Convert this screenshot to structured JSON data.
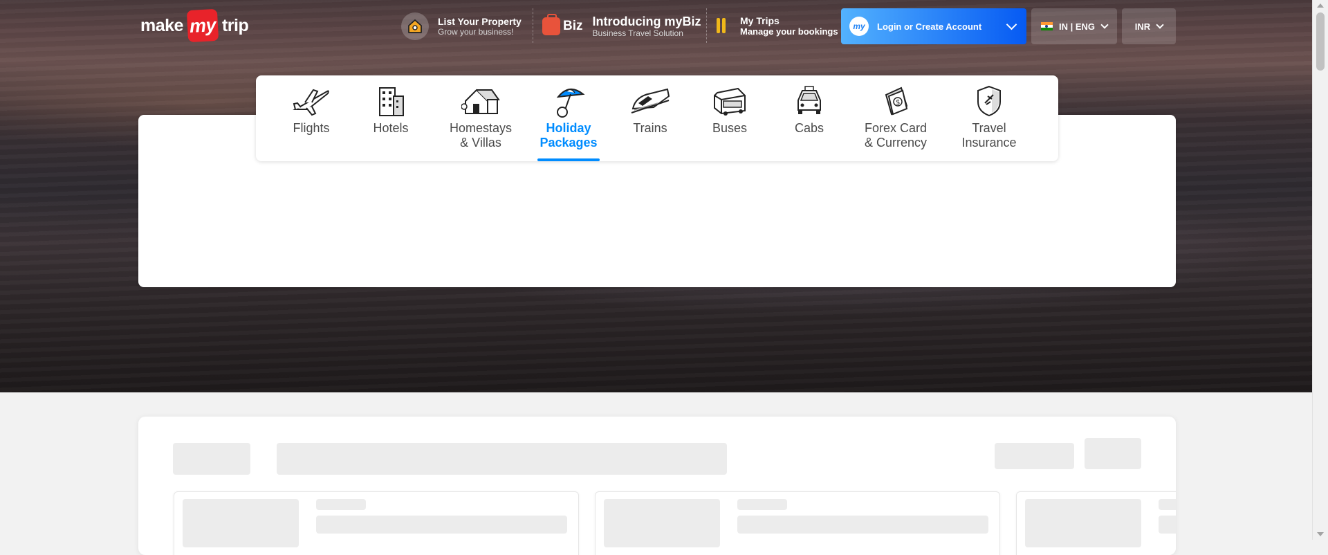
{
  "header": {
    "logo": {
      "part1": "make",
      "part2": "my",
      "part3": "trip"
    },
    "list_property": {
      "title": "List Your Property",
      "subtitle": "Grow your business!"
    },
    "mybiz": {
      "badge": "Biz",
      "title": "Introducing myBiz",
      "subtitle": "Business Travel Solution"
    },
    "my_trips": {
      "title": "My Trips",
      "subtitle": "Manage your bookings"
    },
    "login": {
      "avatar_text": "my",
      "label": "Login or Create Account"
    },
    "language": {
      "label": "IN | ENG"
    },
    "currency": {
      "label": "INR"
    }
  },
  "nav": {
    "items": [
      {
        "label": "Flights",
        "icon": "airplane-icon"
      },
      {
        "label": "Hotels",
        "icon": "hotel-building-icon"
      },
      {
        "label": "Homestays\n& Villas",
        "icon": "house-icon"
      },
      {
        "label": "Holiday\nPackages",
        "icon": "beach-umbrella-icon",
        "active": true
      },
      {
        "label": "Trains",
        "icon": "train-icon"
      },
      {
        "label": "Buses",
        "icon": "bus-icon"
      },
      {
        "label": "Cabs",
        "icon": "car-icon"
      },
      {
        "label": "Forex Card\n& Currency",
        "icon": "forex-card-icon"
      },
      {
        "label": "Travel\nInsurance",
        "icon": "shield-icon"
      }
    ]
  },
  "colors": {
    "accent": "#008cff",
    "login_gradient_start": "#53b2fe",
    "login_gradient_end": "#065af3",
    "brand_red": "#e8232a",
    "skeleton": "#ececec"
  },
  "content": {
    "loading": true
  }
}
